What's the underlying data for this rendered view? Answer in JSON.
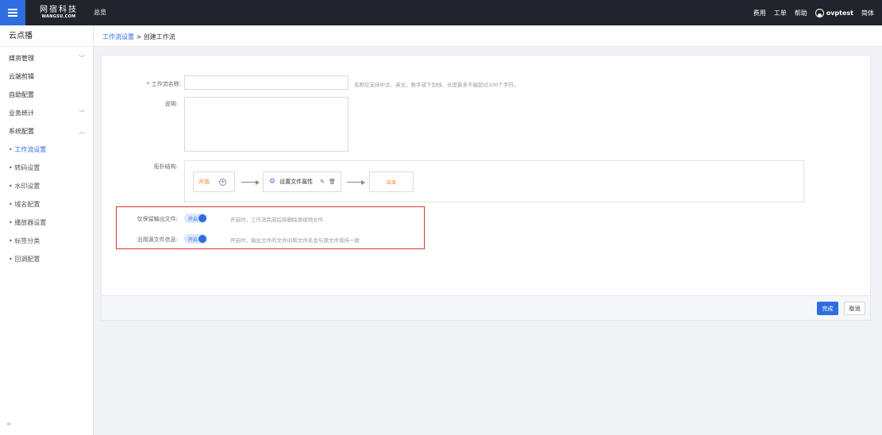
{
  "topbar": {
    "logo_line1": "网宿科技",
    "logo_line2": "WANGSU.COM",
    "overview": "总览",
    "billing": "费用",
    "ticket": "工单",
    "help": "帮助",
    "username": "ovptest",
    "language": "简体"
  },
  "sidebar": {
    "title": "云点播",
    "items": [
      {
        "label": "媒资管理",
        "arrow": "﹀"
      },
      {
        "label": "云端剪辑"
      },
      {
        "label": "自助配置"
      },
      {
        "label": "业务统计",
        "arrow": "﹀"
      },
      {
        "label": "系统配置",
        "arrow": "︿"
      }
    ],
    "subitems": [
      {
        "label": "工作流设置"
      },
      {
        "label": "转码设置"
      },
      {
        "label": "水印设置"
      },
      {
        "label": "域名配置"
      },
      {
        "label": "播放器设置"
      },
      {
        "label": "标签分类"
      },
      {
        "label": "回调配置"
      }
    ],
    "collapse": "«"
  },
  "breadcrumb": {
    "parent": "工作流设置",
    "separator": ">",
    "current": "创建工作流"
  },
  "form": {
    "name_required": "*",
    "name_label": "工作流名称:",
    "name_value": "",
    "name_hint": "名称仅支持中文、英文、数字或下划线，长度最多不能超过100个字符。",
    "desc_label": "说明:",
    "desc_value": "",
    "topology_label": "拓扑结构:",
    "topology": {
      "start": "开始",
      "plus": "+",
      "task": "设置文件属性",
      "end": "结束"
    },
    "toggle1": {
      "label": "仅保留输出文件:",
      "state": "开启",
      "on": true,
      "desc": "开启时，工作流完成后将删除源视频文件"
    },
    "toggle2": {
      "label": "沿用源文件信息:",
      "state": "开启",
      "on": true,
      "desc": "开启时，输出文件的文件ID和文件名会与源文件保持一致"
    }
  },
  "footer": {
    "submit": "完成",
    "cancel": "取消"
  },
  "colors": {
    "accent": "#2f6de1",
    "topbar": "#22242c",
    "highlight": "#e0302e",
    "start_end": "#f08a24"
  }
}
